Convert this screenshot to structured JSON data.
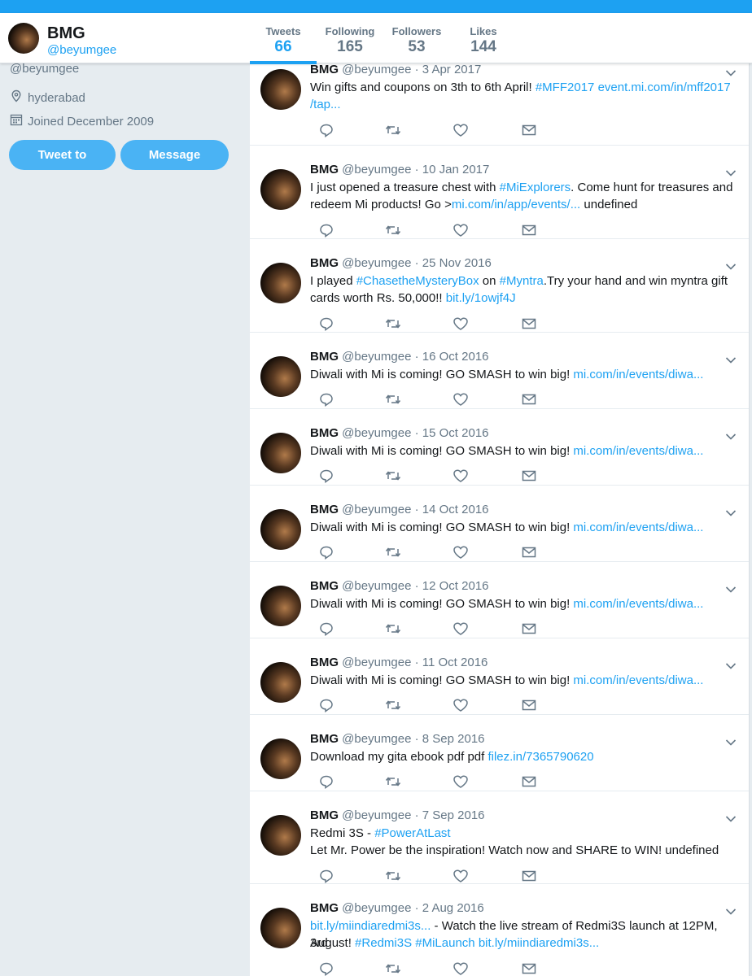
{
  "profile": {
    "name": "BMG",
    "handle": "@beyumgee",
    "location": "hyderabad",
    "joined": "Joined December 2009",
    "tweet_to_label": "Tweet to",
    "message_label": "Message"
  },
  "stats": [
    {
      "label": "Tweets",
      "value": "66"
    },
    {
      "label": "Following",
      "value": "165"
    },
    {
      "label": "Followers",
      "value": "53"
    },
    {
      "label": "Likes",
      "value": "144"
    }
  ],
  "tweets": [
    {
      "name": "BMG",
      "meta": "@beyumgee · 3 Apr 2017",
      "l1": [
        {
          "t": "Win gifts and coupons on 3th to 6th April! "
        },
        {
          "t": "#MFF2017",
          "link": true
        },
        {
          "t": " "
        },
        {
          "t": "event.mi.com/in/mff2017",
          "link": true
        }
      ],
      "l2": [
        {
          "t": "/tap...",
          "link": true
        }
      ]
    },
    {
      "name": "BMG",
      "meta": "@beyumgee · 10 Jan 2017",
      "l1": [
        {
          "t": "I just opened a treasure chest with "
        },
        {
          "t": "#MiExplorers",
          "link": true
        },
        {
          "t": ". Come hunt for treasures and"
        }
      ],
      "l2": [
        {
          "t": "redeem Mi products! Go >"
        },
        {
          "t": "mi.com/in/app/events/...",
          "link": true
        },
        {
          "t": " undefined"
        }
      ]
    },
    {
      "name": "BMG",
      "meta": "@beyumgee · 25 Nov 2016",
      "l1": [
        {
          "t": "I played "
        },
        {
          "t": "#ChasetheMysteryBox",
          "link": true
        },
        {
          "t": " on "
        },
        {
          "t": "#Myntra",
          "link": true
        },
        {
          "t": ".Try your hand and win myntra gift"
        }
      ],
      "l2": [
        {
          "t": "cards worth Rs. 50,000!! "
        },
        {
          "t": "bit.ly/1owjf4J",
          "link": true
        }
      ]
    },
    {
      "name": "BMG",
      "meta": "@beyumgee · 16 Oct 2016",
      "l1": [
        {
          "t": "Diwali with Mi is coming! GO SMASH to win big! "
        },
        {
          "t": "mi.com/in/events/diwa...",
          "link": true
        }
      ],
      "l2": []
    },
    {
      "name": "BMG",
      "meta": "@beyumgee · 15 Oct 2016",
      "l1": [
        {
          "t": "Diwali with Mi is coming! GO SMASH to win big! "
        },
        {
          "t": "mi.com/in/events/diwa...",
          "link": true
        }
      ],
      "l2": []
    },
    {
      "name": "BMG",
      "meta": "@beyumgee · 14 Oct 2016",
      "l1": [
        {
          "t": "Diwali with Mi is coming! GO SMASH to win big! "
        },
        {
          "t": "mi.com/in/events/diwa...",
          "link": true
        }
      ],
      "l2": []
    },
    {
      "name": "BMG",
      "meta": "@beyumgee · 12 Oct 2016",
      "l1": [
        {
          "t": "Diwali with Mi is coming! GO SMASH to win big! "
        },
        {
          "t": "mi.com/in/events/diwa...",
          "link": true
        }
      ],
      "l2": []
    },
    {
      "name": "BMG",
      "meta": "@beyumgee · 11 Oct 2016",
      "l1": [
        {
          "t": "Diwali with Mi is coming! GO SMASH to win big! "
        },
        {
          "t": "mi.com/in/events/diwa...",
          "link": true
        }
      ],
      "l2": []
    },
    {
      "name": "BMG",
      "meta": "@beyumgee · 8 Sep 2016",
      "l1": [
        {
          "t": "Download my gita ebook pdf pdf "
        },
        {
          "t": "filez.in/7365790620",
          "link": true
        }
      ],
      "l2": []
    },
    {
      "name": "BMG",
      "meta": "@beyumgee · 7 Sep 2016",
      "l1": [
        {
          "t": "Redmi 3S - "
        },
        {
          "t": "#PowerAtLast",
          "link": true
        }
      ],
      "l2": [
        {
          "t": " Let Mr. Power be the inspiration! Watch now and SHARE to WIN! undefined"
        }
      ]
    },
    {
      "name": "BMG",
      "meta": "@beyumgee · 2 Aug 2016",
      "l1": [
        {
          "t": "bit.ly/miindiaredmi3s...",
          "link": true
        },
        {
          "t": " - Watch the live stream of Redmi3S launch at 12PM, 3rd"
        }
      ],
      "l2": [
        {
          "t": "August! "
        },
        {
          "t": "#Redmi3S",
          "link": true
        },
        {
          "t": " "
        },
        {
          "t": "#MiLaunch",
          "link": true
        },
        {
          "t": " "
        },
        {
          "t": "bit.ly/miindiaredmi3s...",
          "link": true
        }
      ]
    }
  ]
}
